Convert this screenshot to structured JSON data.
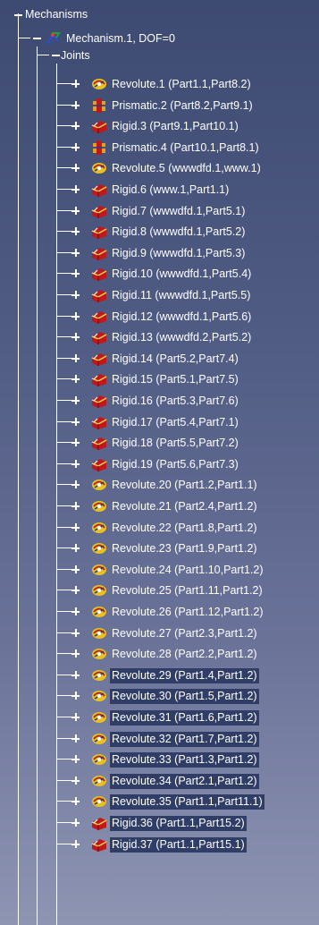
{
  "root": {
    "label": "Mechanisms",
    "expanded": true
  },
  "mechanism": {
    "label": "Mechanism.1, DOF=0",
    "icon": "mechanism-icon",
    "expanded": true
  },
  "joints_group": {
    "label": "Joints",
    "expanded": true
  },
  "joints": [
    {
      "label": "Revolute.1 (Part1.1,Part8.2)",
      "icon": "revolute-icon",
      "selected": false
    },
    {
      "label": "Prismatic.2 (Part8.2,Part9.1)",
      "icon": "prismatic-icon",
      "selected": false
    },
    {
      "label": "Rigid.3 (Part9.1,Part10.1)",
      "icon": "rigid-icon",
      "selected": false
    },
    {
      "label": "Prismatic.4 (Part10.1,Part8.1)",
      "icon": "prismatic-icon",
      "selected": false
    },
    {
      "label": "Revolute.5 (wwwdfd.1,www.1)",
      "icon": "revolute-icon",
      "selected": false
    },
    {
      "label": "Rigid.6 (www.1,Part1.1)",
      "icon": "rigid-icon",
      "selected": false
    },
    {
      "label": "Rigid.7 (wwwdfd.1,Part5.1)",
      "icon": "rigid-icon",
      "selected": false
    },
    {
      "label": "Rigid.8 (wwwdfd.1,Part5.2)",
      "icon": "rigid-icon",
      "selected": false
    },
    {
      "label": "Rigid.9 (wwwdfd.1,Part5.3)",
      "icon": "rigid-icon",
      "selected": false
    },
    {
      "label": "Rigid.10 (wwwdfd.1,Part5.4)",
      "icon": "rigid-icon",
      "selected": false
    },
    {
      "label": "Rigid.11 (wwwdfd.1,Part5.5)",
      "icon": "rigid-icon",
      "selected": false
    },
    {
      "label": "Rigid.12 (wwwdfd.1,Part5.6)",
      "icon": "rigid-icon",
      "selected": false
    },
    {
      "label": "Rigid.13 (wwwdfd.2,Part5.2)",
      "icon": "rigid-icon",
      "selected": false
    },
    {
      "label": "Rigid.14 (Part5.2,Part7.4)",
      "icon": "rigid-icon",
      "selected": false
    },
    {
      "label": "Rigid.15 (Part5.1,Part7.5)",
      "icon": "rigid-icon",
      "selected": false
    },
    {
      "label": "Rigid.16 (Part5.3,Part7.6)",
      "icon": "rigid-icon",
      "selected": false
    },
    {
      "label": "Rigid.17 (Part5.4,Part7.1)",
      "icon": "rigid-icon",
      "selected": false
    },
    {
      "label": "Rigid.18 (Part5.5,Part7.2)",
      "icon": "rigid-icon",
      "selected": false
    },
    {
      "label": "Rigid.19 (Part5.6,Part7.3)",
      "icon": "rigid-icon",
      "selected": false
    },
    {
      "label": "Revolute.20 (Part1.2,Part1.1)",
      "icon": "revolute-icon",
      "selected": false
    },
    {
      "label": "Revolute.21 (Part2.4,Part1.2)",
      "icon": "revolute-icon",
      "selected": false
    },
    {
      "label": "Revolute.22 (Part1.8,Part1.2)",
      "icon": "revolute-icon",
      "selected": false
    },
    {
      "label": "Revolute.23 (Part1.9,Part1.2)",
      "icon": "revolute-icon",
      "selected": false
    },
    {
      "label": "Revolute.24 (Part1.10,Part1.2)",
      "icon": "revolute-icon",
      "selected": false
    },
    {
      "label": "Revolute.25 (Part1.11,Part1.2)",
      "icon": "revolute-icon",
      "selected": false
    },
    {
      "label": "Revolute.26 (Part1.12,Part1.2)",
      "icon": "revolute-icon",
      "selected": false
    },
    {
      "label": "Revolute.27 (Part2.3,Part1.2)",
      "icon": "revolute-icon",
      "selected": false
    },
    {
      "label": "Revolute.28 (Part2.2,Part1.2)",
      "icon": "revolute-icon",
      "selected": false
    },
    {
      "label": "Revolute.29 (Part1.4,Part1.2)",
      "icon": "revolute-icon",
      "selected": true
    },
    {
      "label": "Revolute.30 (Part1.5,Part1.2)",
      "icon": "revolute-icon",
      "selected": true
    },
    {
      "label": "Revolute.31 (Part1.6,Part1.2)",
      "icon": "revolute-icon",
      "selected": true
    },
    {
      "label": "Revolute.32 (Part1.7,Part1.2)",
      "icon": "revolute-icon",
      "selected": true
    },
    {
      "label": "Revolute.33 (Part1.3,Part1.2)",
      "icon": "revolute-icon",
      "selected": true
    },
    {
      "label": "Revolute.34 (Part2.1,Part1.2)",
      "icon": "revolute-icon",
      "selected": true
    },
    {
      "label": "Revolute.35 (Part1.1,Part11.1)",
      "icon": "revolute-icon",
      "selected": true
    },
    {
      "label": "Rigid.36 (Part1.1,Part15.2)",
      "icon": "rigid-icon",
      "selected": true
    },
    {
      "label": "Rigid.37 (Part1.1,Part15.1)",
      "icon": "rigid-icon",
      "selected": true
    }
  ],
  "colors": {
    "background_top": "#3d4a72",
    "background_bottom": "#8e95b3",
    "selection": "#303d66",
    "text": "#ffffff",
    "tree_lines": "#ffffff",
    "rigid_icon": "#c0181c",
    "revolute_icon": "#e8c020",
    "prismatic_icon": "#e0a020"
  }
}
